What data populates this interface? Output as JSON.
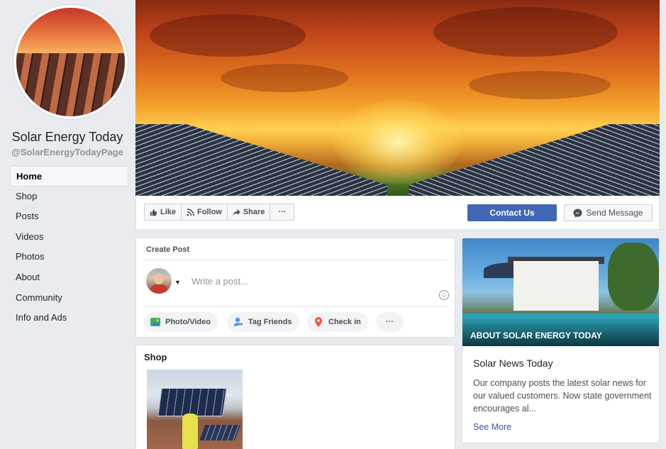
{
  "page": {
    "name": "Solar Energy Today",
    "handle": "@SolarEnergyTodayPage"
  },
  "sidebar": {
    "items": [
      {
        "label": "Home",
        "active": true
      },
      {
        "label": "Shop"
      },
      {
        "label": "Posts"
      },
      {
        "label": "Videos"
      },
      {
        "label": "Photos"
      },
      {
        "label": "About"
      },
      {
        "label": "Community"
      },
      {
        "label": "Info and Ads"
      }
    ]
  },
  "actions": {
    "like": "Like",
    "follow": "Follow",
    "share": "Share",
    "more": "···",
    "contact": "Contact Us",
    "message": "Send Message"
  },
  "create_post": {
    "header": "Create Post",
    "placeholder": "Write a post...",
    "photo_video": "Photo/Video",
    "tag_friends": "Tag Friends",
    "check_in": "Check in",
    "more": "···"
  },
  "shop": {
    "title": "Shop"
  },
  "about": {
    "label": "ABOUT SOLAR ENERGY TODAY",
    "title": "Solar News Today",
    "description": "Our company posts the latest solar news for our valued customers. Now state government encourages al...",
    "see_more": "See More"
  },
  "colors": {
    "brand_blue": "#4267b2",
    "link_blue": "#365899",
    "background": "#e9ebee"
  }
}
